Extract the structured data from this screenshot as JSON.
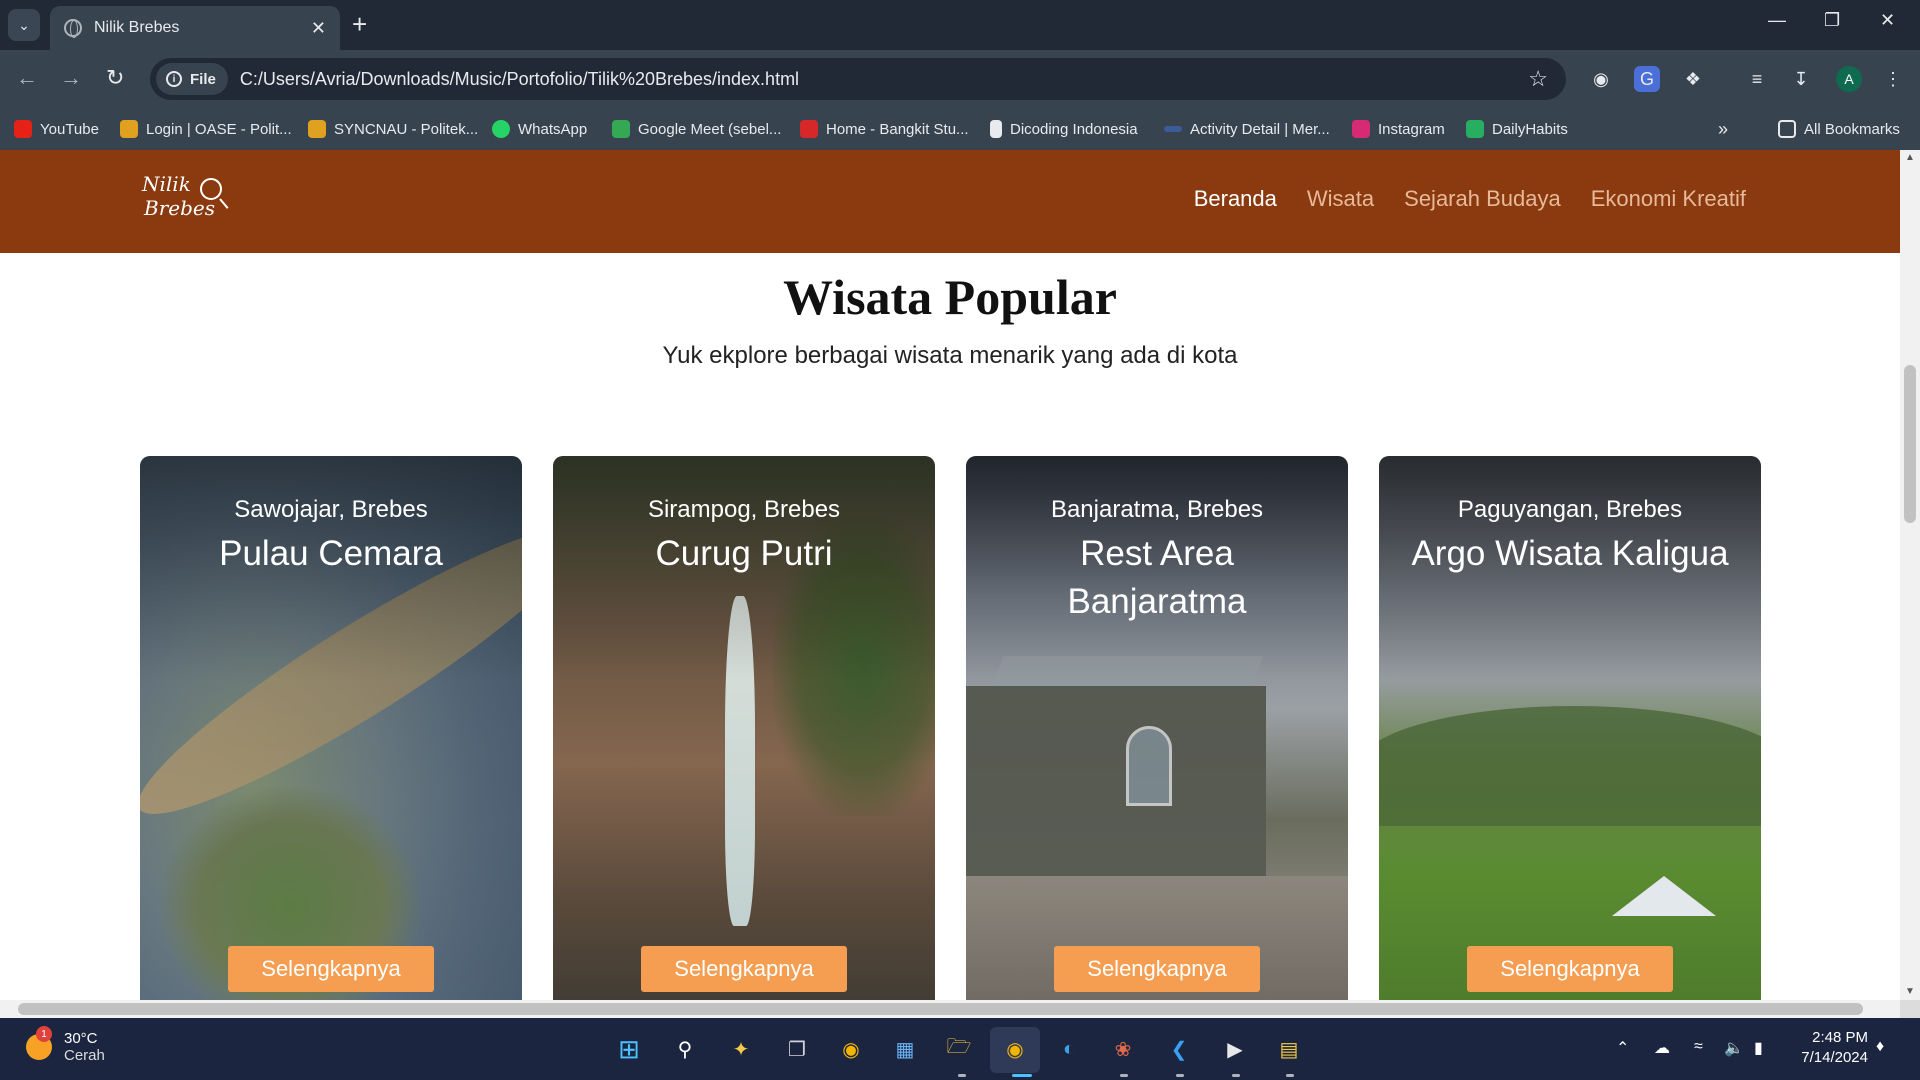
{
  "browser": {
    "tab_title": "Nilik Brebes",
    "new_tab": "+",
    "file_chip": "File",
    "url": "C:/Users/Avria/Downloads/Music/Portofolio/Tilik%20Brebes/index.html",
    "bookmarks": [
      "YouTube",
      "Login | OASE - Polit...",
      "SYNCNAU - Politek...",
      "WhatsApp",
      "Google Meet (sebel...",
      "Home - Bangkit Stu...",
      "Dicoding Indonesia",
      "Activity Detail | Mer...",
      "Instagram",
      "DailyHabits"
    ],
    "all_bookmarks": "All Bookmarks",
    "profile_initial": "A"
  },
  "site": {
    "logo_line1": "Nilik",
    "logo_line2": "Brebes",
    "nav": [
      "Beranda",
      "Wisata",
      "Sejarah Budaya",
      "Ekonomi Kreatif"
    ],
    "active_nav": "Beranda",
    "section_title": "Wisata Popular",
    "section_subtitle": "Yuk ekplore berbagai wisata menarik yang ada di kota",
    "cards": [
      {
        "location": "Sawojajar, Brebes",
        "name": "Pulau Cemara",
        "button": "Selengkapnya"
      },
      {
        "location": "Sirampog, Brebes",
        "name": "Curug Putri",
        "button": "Selengkapnya"
      },
      {
        "location": "Banjaratma, Brebes",
        "name": "Rest Area Banjaratma",
        "button": "Selengkapnya"
      },
      {
        "location": "Paguyangan, Brebes",
        "name": "Argo Wisata Kaligua",
        "button": "Selengkapnya"
      }
    ]
  },
  "taskbar": {
    "weather_temp": "30°C",
    "weather_desc": "Cerah",
    "weather_badge": "1",
    "time": "2:48 PM",
    "date": "7/14/2024"
  },
  "colors": {
    "header_bg": "#8a3a0e",
    "button_orange": "#f59e52",
    "browser_dark": "#202935",
    "browser_toolbar": "#37434f"
  }
}
